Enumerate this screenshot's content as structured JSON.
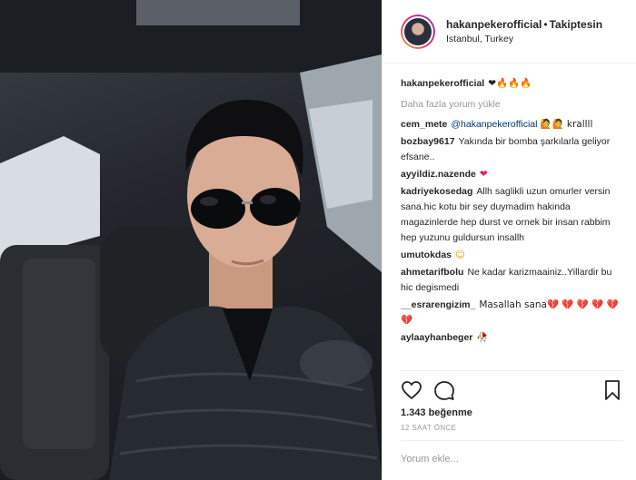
{
  "post": {
    "username": "hakanpekerofficial",
    "follow_status": "Takiptesin",
    "location": "Istanbul, Turkey",
    "caption_user": "hakanpekerofficial",
    "caption_emojis": "❤🔥🔥🔥",
    "load_more": "Daha fazla yorum yükle",
    "likes": "1.343 beğenme",
    "timestamp": "12 SAAT ÖNCE",
    "comment_placeholder": "Yorum ekle..."
  },
  "comments": [
    {
      "user": "cem_mete",
      "mention": "@hakanpekerofficial",
      "text": "🙋🙋 krallll"
    },
    {
      "user": "bozbay9617",
      "mention": "",
      "text": "Yakında bir bomba şarkılarla geliyor efsane.."
    },
    {
      "user": "ayyildiz.nazende",
      "mention": "",
      "text": "❤"
    },
    {
      "user": "kadriyekosedag",
      "mention": "",
      "text": "Allh saglikli uzun omurler versin sana.hic kotu bir sey duymadim hakinda magazinlerde hep durst ve ornek bir insan rabbim hep yuzunu guldursun insallh"
    },
    {
      "user": "umutokdas",
      "mention": "",
      "text": "☺"
    },
    {
      "user": "ahmetarifbolu",
      "mention": "",
      "text": "Ne kadar karizmaainiz..Yillardir bu hic degismedi"
    },
    {
      "user": "__esrarengizim_",
      "mention": "",
      "text": "Masallah sana💔 💔 💔 💔 💔 💔"
    },
    {
      "user": "aylaayhanbeger",
      "mention": "",
      "text": "🥀"
    }
  ],
  "icons": [
    "heart-icon",
    "comment-icon",
    "share-icon",
    "bookmark-icon"
  ],
  "colors": {
    "border": "#efefef",
    "muted": "#999999",
    "link": "#003569"
  }
}
